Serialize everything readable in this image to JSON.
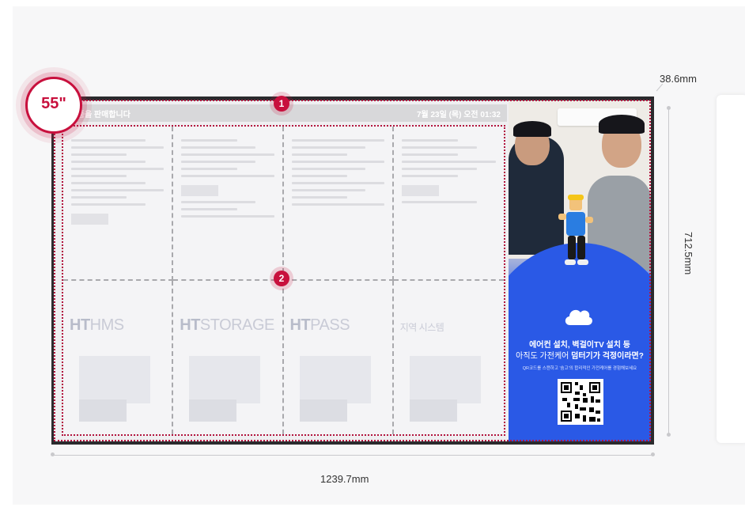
{
  "screen_size_badge": "55\"",
  "zone_markers": [
    "1",
    "2"
  ],
  "topbar": {
    "left_text": "/ 상품을 판매합니다",
    "right_text": "7월 23일 (목)   오전 01:32"
  },
  "dimensions": {
    "width": "1239.7mm",
    "height": "712.5mm",
    "depth": "38.6mm"
  },
  "grid_brands": [
    "HMS",
    "STORAGE",
    "PASS",
    "지역 시스템"
  ],
  "ad": {
    "line1": "에어컨 설치, 벽걸이TV 설치 등",
    "line2_pre": "아직도 가전케어 ",
    "line2_bold": "덤터기가 걱정이라면?",
    "small_text": "QR코드를 스캔하고 '숨고'의 합리적인 가전케어를 경험해보세요",
    "icon": "cloud-icon"
  },
  "colors": {
    "accent": "#c8103d",
    "ad_blue": "#1b43d8"
  }
}
